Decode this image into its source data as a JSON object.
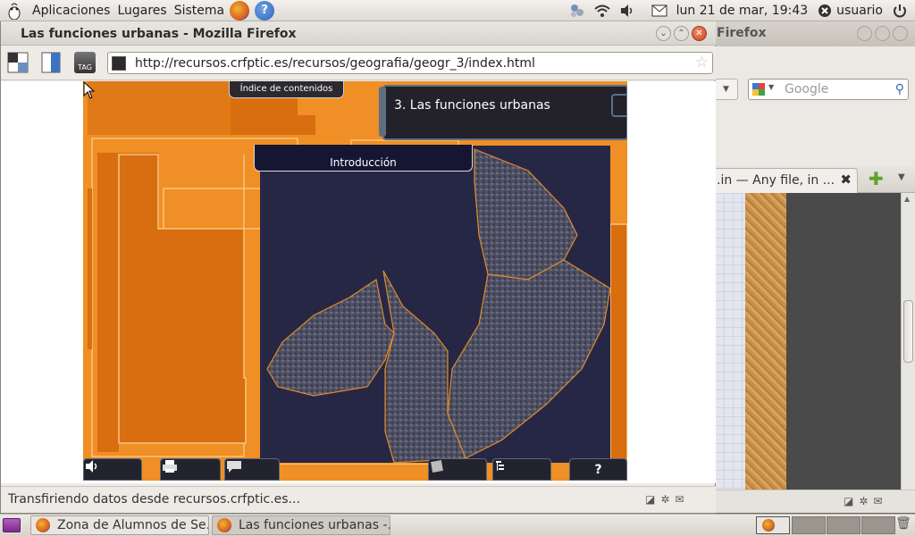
{
  "top_panel": {
    "menus": [
      "Aplicaciones",
      "Lugares",
      "Sistema"
    ],
    "help_glyph": "?",
    "clock": "lun 21 de mar, 19:43",
    "user": "usuario"
  },
  "window": {
    "title": "Las funciones urbanas - Mozilla Firefox",
    "url": "http://recursos.crfptic.es/recursos/geografia/geogr_3/index.html",
    "status": "Transfiriendo datos desde recursos.crfptic.es...",
    "tag_label": "TAG"
  },
  "app": {
    "index_tab": "Índice de contenidos",
    "section_title": "3. Las funciones urbanas",
    "intro_label": "Introducción",
    "help_glyph": "?"
  },
  "bg_window": {
    "title": "Firefox",
    "search_placeholder": "Google",
    "tab_title": ".in — Any file, in ..."
  },
  "taskbar": {
    "tasks": [
      "Zona de Alumnos de Se...",
      "Las funciones urbanas -..."
    ]
  },
  "icons": {
    "top_panel": [
      "foot-icon",
      "firefox-icon",
      "help-icon",
      "network-icon",
      "wifi-icon",
      "volume-icon",
      "mail-icon",
      "power-icon"
    ],
    "app_toolbar": [
      "speaker-icon",
      "print-icon",
      "chat-icon",
      "notes-icon",
      "list-icon",
      "help-icon"
    ]
  },
  "colors": {
    "app_orange": "#ef8f25",
    "app_dark_orange": "#d86e10",
    "map_dark": "#262745",
    "district_outline": "#e08a2a"
  }
}
